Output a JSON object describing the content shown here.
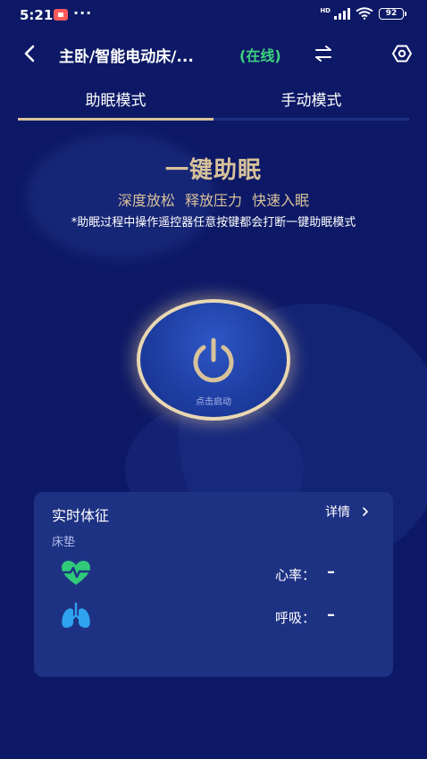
{
  "status_bar": {
    "time": "5:21",
    "dots": "···",
    "network": "HD",
    "battery": "92"
  },
  "header": {
    "title": "主卧/智能电动床/...",
    "online_status": "(在线)"
  },
  "tabs": [
    {
      "label": "助眠模式",
      "active": true
    },
    {
      "label": "手动模式",
      "active": false
    }
  ],
  "hero": {
    "title": "一键助眠",
    "subtitle": "深度放松 释放压力 快速入眠",
    "note": "*助眠过程中操作遥控器任意按键都会打断一键助眠模式"
  },
  "power_button": {
    "label": "点击启动",
    "icon": "power-icon"
  },
  "vitals": {
    "title": "实时体征",
    "details_label": "详情",
    "subtitle": "床垫",
    "heart_rate": {
      "label": "心率：",
      "value": "–",
      "icon": "heart-rate-icon"
    },
    "breathing": {
      "label": "呼吸：",
      "value": "–",
      "icon": "lungs-icon"
    }
  },
  "colors": {
    "background": "#0d1966",
    "accent_gold": "#d8c29a",
    "online_green": "#3ed37f",
    "card": "#1e3284",
    "heart_icon": "#2fc979",
    "lungs_icon": "#2fa3f0"
  }
}
